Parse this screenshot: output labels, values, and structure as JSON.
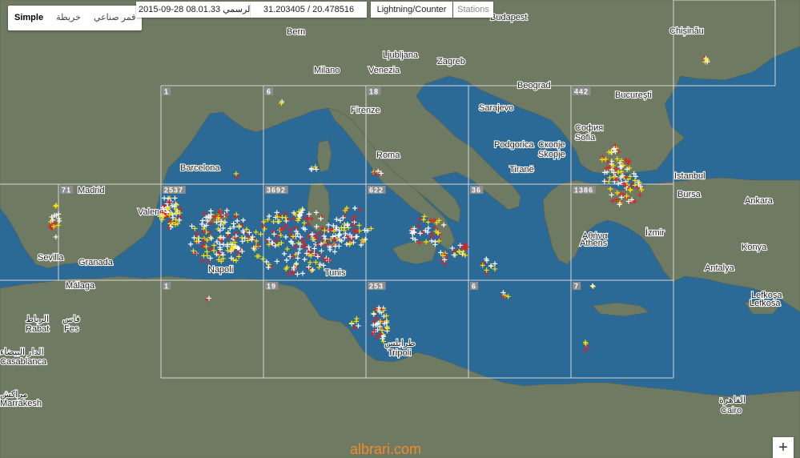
{
  "map_type": {
    "items": [
      "Simple",
      "خريطة",
      "قمر صناعي"
    ],
    "active": 0
  },
  "info": {
    "datetime": "2015-09-28 08.01.33 الرسمي",
    "coords": "31.203405 / 20.478516",
    "mode": "Lightning/Counter",
    "stations": "Stations"
  },
  "grid_counts": [
    {
      "label": "1",
      "row": 0,
      "col": 1
    },
    {
      "label": "6",
      "row": 0,
      "col": 2
    },
    {
      "label": "18",
      "row": 0,
      "col": 3
    },
    {
      "label": "442",
      "row": 0,
      "col": 5
    },
    {
      "label": "71",
      "row": 1,
      "col": 0
    },
    {
      "label": "2537",
      "row": 1,
      "col": 1
    },
    {
      "label": "3692",
      "row": 1,
      "col": 2
    },
    {
      "label": "622",
      "row": 1,
      "col": 3
    },
    {
      "label": "36",
      "row": 1,
      "col": 4
    },
    {
      "label": "1386",
      "row": 1,
      "col": 5
    },
    {
      "label": "1",
      "row": 2,
      "col": 1
    },
    {
      "label": "19",
      "row": 2,
      "col": 2
    },
    {
      "label": "253",
      "row": 2,
      "col": 3
    },
    {
      "label": "6",
      "row": 2,
      "col": 4
    },
    {
      "label": "7",
      "row": 2,
      "col": 5
    }
  ],
  "cities": [
    "Bern",
    "Milano",
    "Ljubljana",
    "Zagreb",
    "Venezia",
    "Budapest",
    "Chișinău",
    "Beograd",
    "Bucureşti",
    "Sarajevo",
    "Firenze",
    "София",
    "Sofia",
    "Podgorica",
    "Скопје",
    "Skopje",
    "Tiranë",
    "Roma",
    "Barcelona",
    "Madrid",
    "Valencia",
    "Istanbul",
    "Bursa",
    "Ankara",
    "Αθήνα",
    "Athens",
    "İzmir",
    "Konya",
    "Antalya",
    "Sevilla",
    "Granada",
    "Málaga",
    "Napoli",
    "Tunis",
    "Lefkoşa",
    "Λευκωσία",
    "Lefkosa",
    "فاس",
    "Fes",
    "الرباط",
    "Rabat",
    "الدار البيضاء",
    "Casablanca",
    "مراكش",
    "Marrakesh",
    "طرابلس",
    "Tripoli",
    "القاهرة",
    "Cairo"
  ],
  "zoom_label": "+",
  "watermark": "albrari.com",
  "colors": {
    "sea": "#2b6a96",
    "land": "#6f7a62",
    "grid": "#d6d6d6",
    "strike_recent": "#ffffff",
    "strike_mid": "#ffe200",
    "strike_old": "#e02020",
    "watermark": "#f28a2e"
  }
}
